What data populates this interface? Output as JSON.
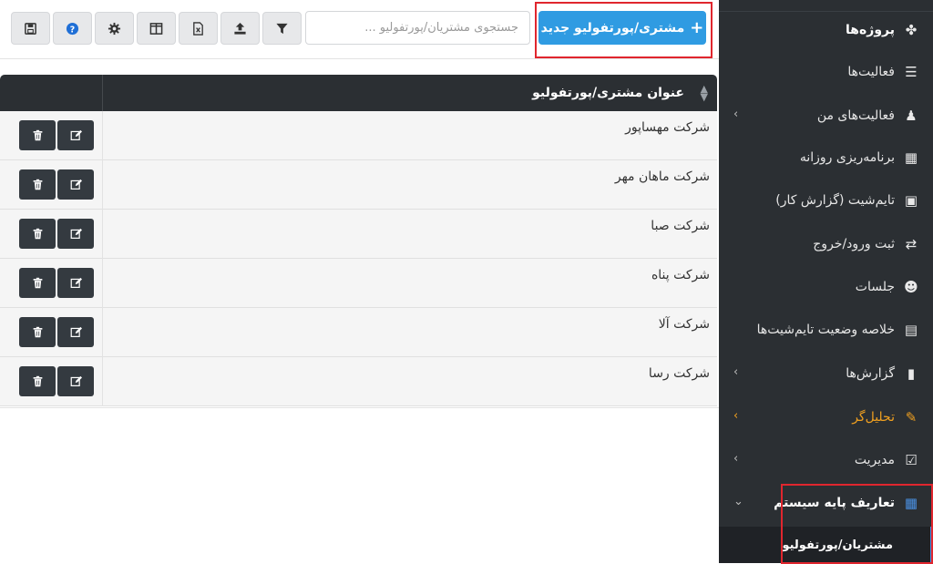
{
  "toolbar": {
    "new_button_label": "مشتری/پورتفولیو جدید",
    "new_button_icon": "plus-icon",
    "search_placeholder": "جستجوی مشتریان/پورتفولیو ...",
    "buttons": [
      "filter-icon",
      "upload-icon",
      "excel-icon",
      "columns-icon",
      "gear-icon",
      "help-icon",
      "save-icon"
    ],
    "accent_color": "#2f9be2"
  },
  "table": {
    "column_header": "عنوان مشتری/پورتفولیو",
    "rows": [
      {
        "name": "شرکت مهساپور"
      },
      {
        "name": "شرکت ماهان مهر"
      },
      {
        "name": "شرکت صبا"
      },
      {
        "name": "شرکت پناه"
      },
      {
        "name": "شرکت آلا"
      },
      {
        "name": "شرکت رسا"
      }
    ],
    "row_actions": [
      "edit-icon",
      "delete-icon"
    ]
  },
  "sidebar": {
    "items": [
      {
        "label": "پروژه‌ها",
        "icon": "projects-icon"
      },
      {
        "label": "فعالیت‌ها",
        "icon": "list-icon"
      },
      {
        "label": "فعالیت‌های من",
        "icon": "user-task-icon"
      },
      {
        "label": "برنامه‌ریزی روزانه",
        "icon": "table-icon"
      },
      {
        "label": "تایم‌شیت (گزارش کار)",
        "icon": "calendar-check-icon"
      },
      {
        "label": "ثبت ورود/خروج",
        "icon": "exchange-icon"
      },
      {
        "label": "جلسات",
        "icon": "users-icon"
      },
      {
        "label": "خلاصه وضعیت تایم‌شیت‌ها",
        "icon": "summary-icon"
      },
      {
        "label": "گزارش‌ها",
        "icon": "file-icon"
      },
      {
        "label": "تحلیل‌گر",
        "icon": "magic-wand-icon"
      },
      {
        "label": "مدیریت",
        "icon": "check-square-icon"
      },
      {
        "label": "تعاریف پایه سیستم",
        "icon": "grid-icon"
      }
    ],
    "sub_item": "مشتریان/پورتفولیو",
    "active_color": "#f0a020",
    "highlight_color": "#e0262e"
  }
}
